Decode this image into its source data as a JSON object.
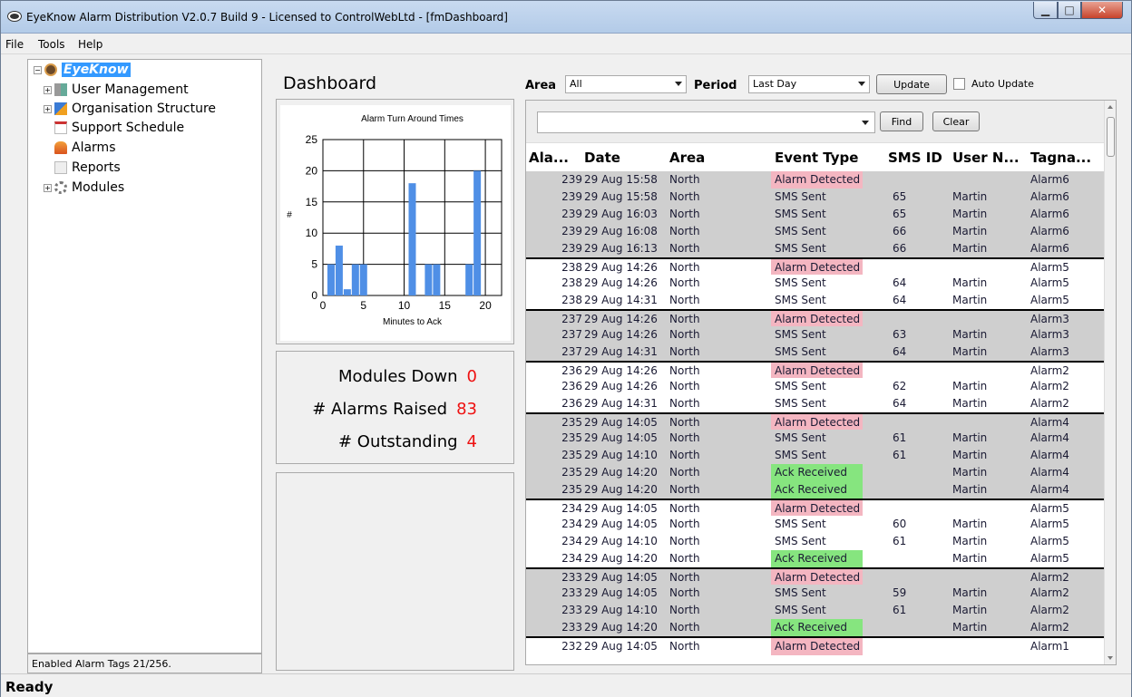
{
  "window": {
    "title": "EyeKnow Alarm Distribution V2.0.7 Build 9 - Licensed to ControlWebLtd - [fmDashboard]"
  },
  "menu": [
    "File",
    "Tools",
    "Help"
  ],
  "tree": {
    "root": "EyeKnow",
    "items": [
      "User Management",
      "Organisation Structure",
      "Support Schedule",
      "Alarms",
      "Reports",
      "Modules"
    ]
  },
  "left_status": "Enabled Alarm Tags 21/256.",
  "dashboard": {
    "title": "Dashboard"
  },
  "chart_data": {
    "type": "bar",
    "title": "Alarm Turn Around Times",
    "xlabel": "Minutes to Ack",
    "ylabel": "#",
    "xlim": [
      0,
      22
    ],
    "ylim": [
      0,
      25
    ],
    "xticks": [
      0,
      5,
      10,
      15,
      20
    ],
    "yticks": [
      0,
      5,
      10,
      15,
      20,
      25
    ],
    "bars": [
      {
        "x": 1,
        "y": 5
      },
      {
        "x": 2,
        "y": 8
      },
      {
        "x": 3,
        "y": 1
      },
      {
        "x": 4,
        "y": 5
      },
      {
        "x": 5,
        "y": 5
      },
      {
        "x": 11,
        "y": 18
      },
      {
        "x": 13,
        "y": 5
      },
      {
        "x": 14,
        "y": 5
      },
      {
        "x": 18,
        "y": 5
      },
      {
        "x": 19,
        "y": 20
      }
    ],
    "grid": true
  },
  "stats": [
    {
      "label": "Modules Down",
      "value": "0"
    },
    {
      "label": "# Alarms Raised",
      "value": "83"
    },
    {
      "label": "# Outstanding",
      "value": "4"
    }
  ],
  "filter": {
    "area_label": "Area",
    "area_value": "All",
    "period_label": "Period",
    "period_value": "Last Day",
    "update_button": "Update",
    "auto_update_label": "Auto Update",
    "find_button": "Find",
    "clear_button": "Clear"
  },
  "grid": {
    "columns": [
      "Ala...",
      "Date",
      "Area",
      "Event Type",
      "SMS ID",
      "User N...",
      "Tagna..."
    ],
    "rows": [
      {
        "al": "239",
        "date": "29 Aug 15:58",
        "area": "North",
        "event": "Alarm Detected",
        "sms": "",
        "user": "",
        "tag": "Alarm6",
        "shade": "g",
        "sep": false
      },
      {
        "al": "239",
        "date": "29 Aug 15:58",
        "area": "North",
        "event": "SMS Sent",
        "sms": "65",
        "user": "Martin",
        "tag": "Alarm6",
        "shade": "g",
        "sep": false
      },
      {
        "al": "239",
        "date": "29 Aug 16:03",
        "area": "North",
        "event": "SMS Sent",
        "sms": "65",
        "user": "Martin",
        "tag": "Alarm6",
        "shade": "g",
        "sep": false
      },
      {
        "al": "239",
        "date": "29 Aug 16:08",
        "area": "North",
        "event": "SMS Sent",
        "sms": "66",
        "user": "Martin",
        "tag": "Alarm6",
        "shade": "g",
        "sep": false
      },
      {
        "al": "239",
        "date": "29 Aug 16:13",
        "area": "North",
        "event": "SMS Sent",
        "sms": "66",
        "user": "Martin",
        "tag": "Alarm6",
        "shade": "g",
        "sep": false
      },
      {
        "al": "238",
        "date": "29 Aug 14:26",
        "area": "North",
        "event": "Alarm Detected",
        "sms": "",
        "user": "",
        "tag": "Alarm5",
        "shade": "w",
        "sep": true
      },
      {
        "al": "238",
        "date": "29 Aug 14:26",
        "area": "North",
        "event": "SMS Sent",
        "sms": "64",
        "user": "Martin",
        "tag": "Alarm5",
        "shade": "w",
        "sep": false
      },
      {
        "al": "238",
        "date": "29 Aug 14:31",
        "area": "North",
        "event": "SMS Sent",
        "sms": "64",
        "user": "Martin",
        "tag": "Alarm5",
        "shade": "w",
        "sep": false
      },
      {
        "al": "237",
        "date": "29 Aug 14:26",
        "area": "North",
        "event": "Alarm Detected",
        "sms": "",
        "user": "",
        "tag": "Alarm3",
        "shade": "g",
        "sep": true
      },
      {
        "al": "237",
        "date": "29 Aug 14:26",
        "area": "North",
        "event": "SMS Sent",
        "sms": "63",
        "user": "Martin",
        "tag": "Alarm3",
        "shade": "g",
        "sep": false
      },
      {
        "al": "237",
        "date": "29 Aug 14:31",
        "area": "North",
        "event": "SMS Sent",
        "sms": "64",
        "user": "Martin",
        "tag": "Alarm3",
        "shade": "g",
        "sep": false
      },
      {
        "al": "236",
        "date": "29 Aug 14:26",
        "area": "North",
        "event": "Alarm Detected",
        "sms": "",
        "user": "",
        "tag": "Alarm2",
        "shade": "w",
        "sep": true
      },
      {
        "al": "236",
        "date": "29 Aug 14:26",
        "area": "North",
        "event": "SMS Sent",
        "sms": "62",
        "user": "Martin",
        "tag": "Alarm2",
        "shade": "w",
        "sep": false
      },
      {
        "al": "236",
        "date": "29 Aug 14:31",
        "area": "North",
        "event": "SMS Sent",
        "sms": "64",
        "user": "Martin",
        "tag": "Alarm2",
        "shade": "w",
        "sep": false
      },
      {
        "al": "235",
        "date": "29 Aug 14:05",
        "area": "North",
        "event": "Alarm Detected",
        "sms": "",
        "user": "",
        "tag": "Alarm4",
        "shade": "g",
        "sep": true
      },
      {
        "al": "235",
        "date": "29 Aug 14:05",
        "area": "North",
        "event": "SMS Sent",
        "sms": "61",
        "user": "Martin",
        "tag": "Alarm4",
        "shade": "g",
        "sep": false
      },
      {
        "al": "235",
        "date": "29 Aug 14:10",
        "area": "North",
        "event": "SMS Sent",
        "sms": "61",
        "user": "Martin",
        "tag": "Alarm4",
        "shade": "g",
        "sep": false
      },
      {
        "al": "235",
        "date": "29 Aug 14:20",
        "area": "North",
        "event": "Ack Received",
        "sms": "",
        "user": "Martin",
        "tag": "Alarm4",
        "shade": "g",
        "sep": false
      },
      {
        "al": "235",
        "date": "29 Aug 14:20",
        "area": "North",
        "event": "Ack Received",
        "sms": "",
        "user": "Martin",
        "tag": "Alarm4",
        "shade": "g",
        "sep": false
      },
      {
        "al": "234",
        "date": "29 Aug 14:05",
        "area": "North",
        "event": "Alarm Detected",
        "sms": "",
        "user": "",
        "tag": "Alarm5",
        "shade": "w",
        "sep": true
      },
      {
        "al": "234",
        "date": "29 Aug 14:05",
        "area": "North",
        "event": "SMS Sent",
        "sms": "60",
        "user": "Martin",
        "tag": "Alarm5",
        "shade": "w",
        "sep": false
      },
      {
        "al": "234",
        "date": "29 Aug 14:10",
        "area": "North",
        "event": "SMS Sent",
        "sms": "61",
        "user": "Martin",
        "tag": "Alarm5",
        "shade": "w",
        "sep": false
      },
      {
        "al": "234",
        "date": "29 Aug 14:20",
        "area": "North",
        "event": "Ack Received",
        "sms": "",
        "user": "Martin",
        "tag": "Alarm5",
        "shade": "w",
        "sep": false
      },
      {
        "al": "233",
        "date": "29 Aug 14:05",
        "area": "North",
        "event": "Alarm Detected",
        "sms": "",
        "user": "",
        "tag": "Alarm2",
        "shade": "g",
        "sep": true
      },
      {
        "al": "233",
        "date": "29 Aug 14:05",
        "area": "North",
        "event": "SMS Sent",
        "sms": "59",
        "user": "Martin",
        "tag": "Alarm2",
        "shade": "g",
        "sep": false
      },
      {
        "al": "233",
        "date": "29 Aug 14:10",
        "area": "North",
        "event": "SMS Sent",
        "sms": "61",
        "user": "Martin",
        "tag": "Alarm2",
        "shade": "g",
        "sep": false
      },
      {
        "al": "233",
        "date": "29 Aug 14:20",
        "area": "North",
        "event": "Ack Received",
        "sms": "",
        "user": "Martin",
        "tag": "Alarm2",
        "shade": "g",
        "sep": false
      },
      {
        "al": "232",
        "date": "29 Aug 14:05",
        "area": "North",
        "event": "Alarm Detected",
        "sms": "",
        "user": "",
        "tag": "Alarm1",
        "shade": "w",
        "sep": true
      }
    ]
  },
  "status": "Ready",
  "colors": {
    "alarm_detected": "#f4b6c1",
    "ack_received": "#86e57f",
    "bar": "#4f8fe6",
    "stat_value": "#e11111"
  }
}
